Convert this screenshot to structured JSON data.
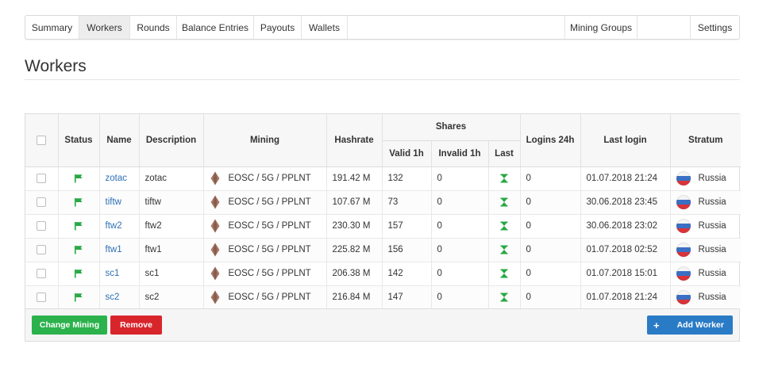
{
  "tabs": [
    {
      "label": "Summary",
      "active": false
    },
    {
      "label": "Workers",
      "active": true
    },
    {
      "label": "Rounds",
      "active": false
    },
    {
      "label": "Balance Entries",
      "active": false
    },
    {
      "label": "Payouts",
      "active": false
    },
    {
      "label": "Wallets",
      "active": false
    }
  ],
  "right_tabs": [
    {
      "label": "Mining Groups"
    },
    {
      "label": ""
    },
    {
      "label": "Settings"
    }
  ],
  "page": {
    "title": "Workers"
  },
  "table": {
    "headers": {
      "status": "Status",
      "name": "Name",
      "description": "Description",
      "mining": "Mining",
      "hashrate": "Hashrate",
      "shares": "Shares",
      "valid": "Valid 1h",
      "invalid": "Invalid 1h",
      "last": "Last",
      "logins": "Logins 24h",
      "last_login": "Last login",
      "stratum": "Stratum"
    },
    "rows": [
      {
        "name": "zotac",
        "description": "zotac",
        "mining": "EOSC / 5G / PPLNT",
        "hashrate": "191.42 M",
        "valid": "132",
        "invalid": "0",
        "logins": "0",
        "last_login": "01.07.2018 21:24",
        "stratum": "Russia"
      },
      {
        "name": "tiftw",
        "description": "tiftw",
        "mining": "EOSC / 5G / PPLNT",
        "hashrate": "107.67 M",
        "valid": "73",
        "invalid": "0",
        "logins": "0",
        "last_login": "30.06.2018 23:45",
        "stratum": "Russia"
      },
      {
        "name": "ftw2",
        "description": "ftw2",
        "mining": "EOSC / 5G / PPLNT",
        "hashrate": "230.30 M",
        "valid": "157",
        "invalid": "0",
        "logins": "0",
        "last_login": "30.06.2018 23:02",
        "stratum": "Russia"
      },
      {
        "name": "ftw1",
        "description": "ftw1",
        "mining": "EOSC / 5G / PPLNT",
        "hashrate": "225.82 M",
        "valid": "156",
        "invalid": "0",
        "logins": "0",
        "last_login": "01.07.2018 02:52",
        "stratum": "Russia"
      },
      {
        "name": "sc1",
        "description": "sc1",
        "mining": "EOSC / 5G / PPLNT",
        "hashrate": "206.38 M",
        "valid": "142",
        "invalid": "0",
        "logins": "0",
        "last_login": "01.07.2018 15:01",
        "stratum": "Russia"
      },
      {
        "name": "sc2",
        "description": "sc2",
        "mining": "EOSC / 5G / PPLNT",
        "hashrate": "216.84 M",
        "valid": "147",
        "invalid": "0",
        "logins": "0",
        "last_login": "01.07.2018 21:24",
        "stratum": "Russia"
      }
    ]
  },
  "buttons": {
    "change_mining": "Change Mining",
    "remove": "Remove",
    "add_worker": "Add Worker"
  },
  "colors": {
    "status_green": "#27a844",
    "link_blue": "#2e6fb5",
    "change_green": "#2bb24c",
    "remove_red": "#d8252b",
    "add_blue": "#2a7bc6"
  },
  "icons": {
    "status": "flag-icon",
    "last_share": "hourglass-icon",
    "coin": "eosc-coin-icon",
    "country": "russia-flag-icon",
    "add": "plus-icon"
  }
}
